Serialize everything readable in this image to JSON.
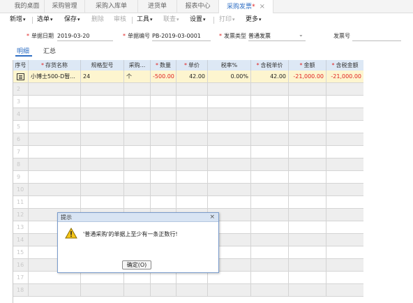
{
  "tabs": [
    {
      "label": "我的桌面"
    },
    {
      "label": "采购管理"
    },
    {
      "label": "采购入库单"
    },
    {
      "label": "进货单"
    },
    {
      "label": "报表中心"
    },
    {
      "label": "采购发票",
      "star": "*",
      "close": "×",
      "active": true
    }
  ],
  "toolbar": {
    "new": "新增",
    "select": "选单",
    "save": "保存",
    "delete": "删除",
    "audit": "审核",
    "tools": "工具",
    "link": "联查",
    "settings": "设置",
    "print": "打印",
    "more": "更多"
  },
  "form": {
    "date_label": "单据日期",
    "date_value": "2019-03-20",
    "code_label": "单据编号",
    "code_value": "PB-2019-03-0001",
    "invoice_type_label": "发票类型",
    "invoice_type_value": "普通发票",
    "invoice_no_label": "发票号",
    "invoice_no_value": ""
  },
  "subtabs": {
    "detail": "明细",
    "summary": "汇总"
  },
  "grid": {
    "headers": [
      "序号",
      "存货名称",
      "规格型号",
      "采购...",
      "数量",
      "单价",
      "税率%",
      "含税单价",
      "金额",
      "含税金额"
    ],
    "required": [
      false,
      true,
      false,
      false,
      true,
      true,
      false,
      true,
      true,
      true
    ],
    "rows": [
      {
        "name": "小博士500-D暂...",
        "spec": "24",
        "unit": "个",
        "qty": "-500.00",
        "price": "42.00",
        "tax_rate": "0.00%",
        "tax_price": "42.00",
        "amount": "-21,000.00",
        "tax_amount": "-21,000.00"
      }
    ],
    "row_numbers": [
      "2",
      "3",
      "4",
      "5",
      "6",
      "7",
      "8",
      "9",
      "10",
      "11",
      "12",
      "13",
      "14",
      "15",
      "16",
      "17",
      "18"
    ]
  },
  "dialog": {
    "title": "提示",
    "close": "×",
    "message": "'普通采购'的单据上至少有一条正数行!",
    "ok_label": "确定(O)"
  },
  "colors": {
    "accent": "#2f6fc4",
    "negative": "#e02020",
    "header_bg": "#dde8f5",
    "selected_row": "#fdf5cf"
  }
}
